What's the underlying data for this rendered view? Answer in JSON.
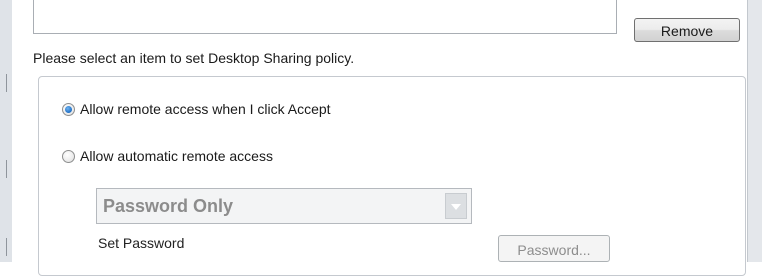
{
  "top": {
    "remove_label": "Remove",
    "instruction": "Please select an item to set Desktop Sharing policy."
  },
  "policy": {
    "options": [
      {
        "label": "Allow remote access when I click Accept",
        "selected": true
      },
      {
        "label": "Allow automatic remote access",
        "selected": false
      }
    ],
    "auth_select": {
      "value": "Password Only",
      "disabled": true
    },
    "set_password_label": "Set Password",
    "password_button_label": "Password...",
    "password_button_disabled": true
  },
  "colors": {
    "radio_selected": "#1f6fc5",
    "disabled_text": "#8c8c8c",
    "group_border": "#c5c9cf"
  }
}
